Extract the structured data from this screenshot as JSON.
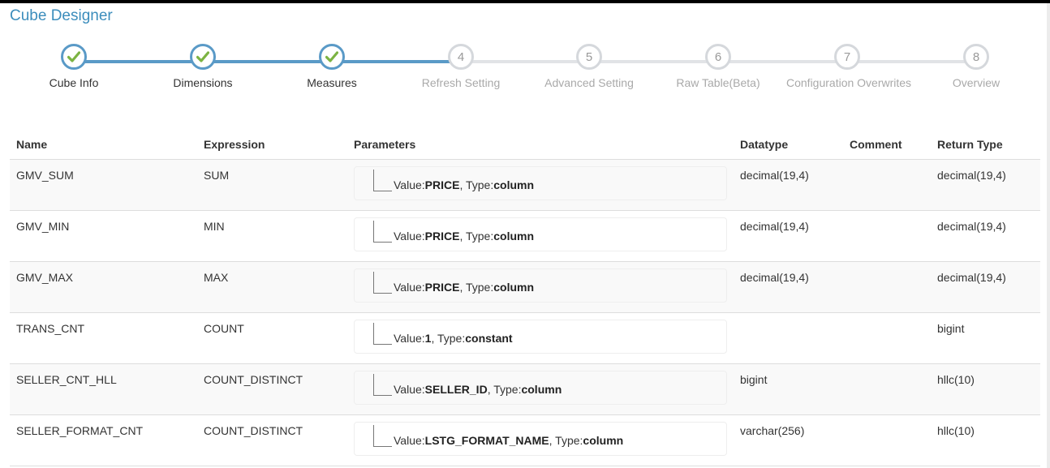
{
  "app": {
    "title": "Cube Designer"
  },
  "colors": {
    "accent": "#5a9ac7",
    "check": "#7cb342",
    "pending": "#d5d8dc"
  },
  "wizard": {
    "steps": [
      {
        "label": "Cube Info",
        "state": "done",
        "number": ""
      },
      {
        "label": "Dimensions",
        "state": "done",
        "number": ""
      },
      {
        "label": "Measures",
        "state": "done",
        "number": ""
      },
      {
        "label": "Refresh Setting",
        "state": "todo",
        "number": "4"
      },
      {
        "label": "Advanced Setting",
        "state": "todo",
        "number": "5"
      },
      {
        "label": "Raw Table(Beta)",
        "state": "todo",
        "number": "6"
      },
      {
        "label": "Configuration Overwrites",
        "state": "todo",
        "number": "7"
      },
      {
        "label": "Overview",
        "state": "todo",
        "number": "8"
      }
    ]
  },
  "table": {
    "headers": {
      "name": "Name",
      "expression": "Expression",
      "parameters": "Parameters",
      "datatype": "Datatype",
      "comment": "Comment",
      "return_type": "Return Type"
    },
    "rows": [
      {
        "name": "GMV_SUM",
        "expression": "SUM",
        "value": "PRICE",
        "type": "column",
        "datatype": "decimal(19,4)",
        "comment": "",
        "return_type": "decimal(19,4)"
      },
      {
        "name": "GMV_MIN",
        "expression": "MIN",
        "value": "PRICE",
        "type": "column",
        "datatype": "decimal(19,4)",
        "comment": "",
        "return_type": "decimal(19,4)"
      },
      {
        "name": "GMV_MAX",
        "expression": "MAX",
        "value": "PRICE",
        "type": "column",
        "datatype": "decimal(19,4)",
        "comment": "",
        "return_type": "decimal(19,4)"
      },
      {
        "name": "TRANS_CNT",
        "expression": "COUNT",
        "value": "1",
        "type": "constant",
        "datatype": "",
        "comment": "",
        "return_type": "bigint"
      },
      {
        "name": "SELLER_CNT_HLL",
        "expression": "COUNT_DISTINCT",
        "value": "SELLER_ID",
        "type": "column",
        "datatype": "bigint",
        "comment": "",
        "return_type": "hllc(10)"
      },
      {
        "name": "SELLER_FORMAT_CNT",
        "expression": "COUNT_DISTINCT",
        "value": "LSTG_FORMAT_NAME",
        "type": "column",
        "datatype": "varchar(256)",
        "comment": "",
        "return_type": "hllc(10)"
      }
    ],
    "param_labels": {
      "value_prefix": "Value:",
      "type_prefix": ", Type:"
    }
  }
}
